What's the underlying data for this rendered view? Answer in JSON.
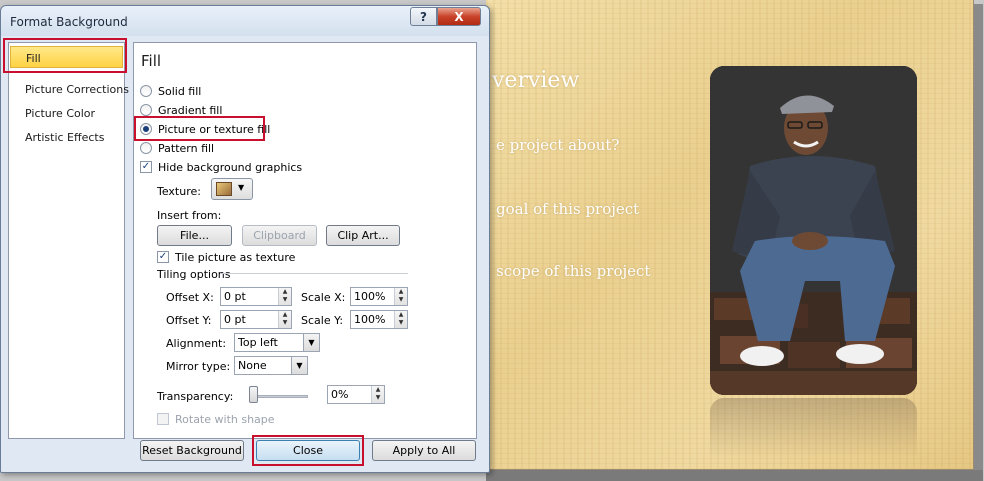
{
  "dialog": {
    "title": "Format Background",
    "help_label": "?",
    "close_label": "X"
  },
  "nav": {
    "items": [
      {
        "label": "Fill"
      },
      {
        "label": "Picture Corrections"
      },
      {
        "label": "Picture Color"
      },
      {
        "label": "Artistic Effects"
      }
    ]
  },
  "fill": {
    "heading": "Fill",
    "options": [
      {
        "label": "Solid fill",
        "checked": false
      },
      {
        "label": "Gradient fill",
        "checked": false
      },
      {
        "label": "Picture or texture fill",
        "checked": true
      },
      {
        "label": "Pattern fill",
        "checked": false
      }
    ],
    "hide_background_graphics": {
      "label": "Hide background graphics",
      "checked": true
    },
    "texture_label": "Texture:",
    "insert_from_label": "Insert from:",
    "file_button": "File...",
    "clipboard_button": "Clipboard",
    "clip_art_button": "Clip Art...",
    "tile_picture": {
      "label": "Tile picture as texture",
      "checked": true
    },
    "tiling_options_label": "Tiling options",
    "offset_x_label": "Offset X:",
    "offset_x_value": "0 pt",
    "scale_x_label": "Scale X:",
    "scale_x_value": "100%",
    "offset_y_label": "Offset Y:",
    "offset_y_value": "0 pt",
    "scale_y_label": "Scale Y:",
    "scale_y_value": "100%",
    "alignment_label": "Alignment:",
    "alignment_value": "Top left",
    "mirror_type_label": "Mirror type:",
    "mirror_type_value": "None",
    "transparency_label": "Transparency:",
    "transparency_value": "0%",
    "transparency_level": 0,
    "rotate_with_shape": {
      "label": "Rotate with shape",
      "checked": false
    }
  },
  "footer": {
    "reset_button": "Reset Background",
    "close_button": "Close",
    "apply_all_button": "Apply to All"
  },
  "slide": {
    "title": "verview",
    "bullets": [
      "e project about?",
      "goal of this project",
      "scope of this project"
    ]
  },
  "colors": {
    "highlight": "#c8102e",
    "selected_nav": "#ffd243",
    "slide_background": "#ead08f"
  }
}
